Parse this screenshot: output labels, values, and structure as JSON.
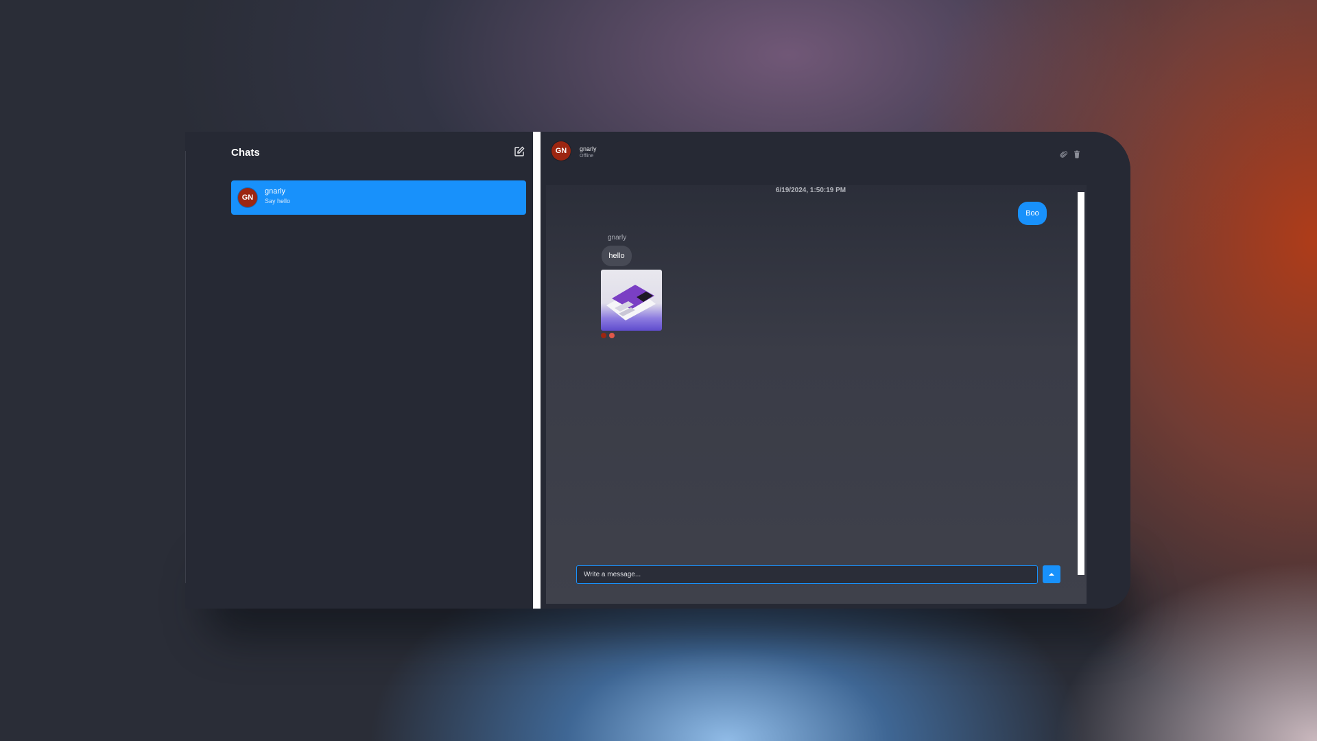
{
  "sidebar": {
    "title": "Chats",
    "compose_icon": "compose-icon",
    "chats": [
      {
        "initials": "GN",
        "name": "gnarly",
        "preview": "Say hello",
        "selected": true
      }
    ]
  },
  "header": {
    "initials": "GN",
    "name": "gnarly",
    "status": "Offline",
    "icons": [
      "attachment-icon",
      "trash-icon"
    ]
  },
  "conversation": {
    "timestamp": "6/19/2024, 1:50:19 PM",
    "messages": [
      {
        "direction": "sent",
        "text": "Boo"
      },
      {
        "direction": "received",
        "sender": "gnarly",
        "text": "hello"
      },
      {
        "direction": "received",
        "sender": "gnarly",
        "type": "image"
      }
    ]
  },
  "composer": {
    "placeholder": "Write a message...",
    "send_icon": "send-arrow-icon"
  },
  "colors": {
    "accent": "#1891fb",
    "avatar": "#9c2611",
    "panel": "#262934"
  }
}
